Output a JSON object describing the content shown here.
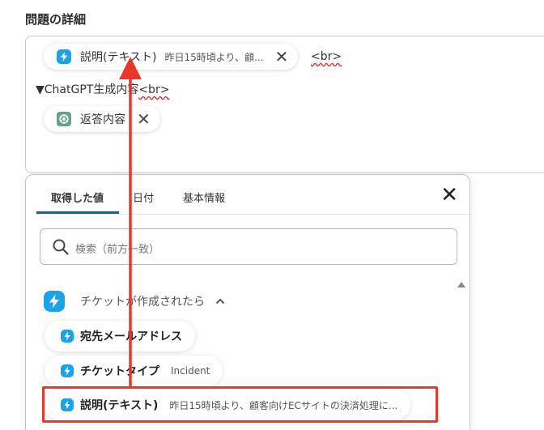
{
  "section": {
    "title": "問題の詳細"
  },
  "editor": {
    "chip1": {
      "icon": "zendesk-lightning-icon",
      "label": "説明(テキスト)",
      "preview": "昨日15時頃より、顧..."
    },
    "br1": "<br>",
    "line2_prefix": "▼ChatGPT生成内容",
    "line2_br": "<br>",
    "chip2": {
      "icon": "chatgpt-icon",
      "label": "返答内容"
    }
  },
  "dropdown": {
    "tabs": [
      {
        "label": "取得した値"
      },
      {
        "label": "日付"
      },
      {
        "label": "基本情報"
      }
    ],
    "search": {
      "placeholder": "検索（前方一致）"
    },
    "group": {
      "label": "チケットが作成されたら"
    },
    "items": [
      {
        "label": "宛先メールアドレス",
        "preview": ""
      },
      {
        "label": "チケットタイプ",
        "preview": "Incident"
      },
      {
        "label": "説明(テキスト)",
        "preview": "昨日15時頃より、顧客向けECサイトの決済処理に..."
      }
    ]
  },
  "colors": {
    "accent": "#1d5f8a",
    "zendesk_blue": "#1aa3e8",
    "highlight_red": "#e8372b",
    "chatgpt_green": "#6b9e8c"
  }
}
